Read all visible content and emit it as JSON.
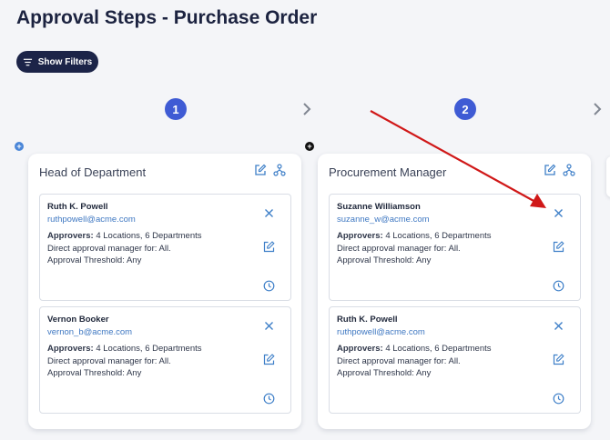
{
  "page": {
    "title": "Approval Steps - Purchase Order"
  },
  "filters": {
    "button_label": "Show Filters",
    "icon": "filter-lines-icon"
  },
  "steps": [
    {
      "number": "1",
      "role": "Head of Department",
      "approvers": [
        {
          "name": "Ruth K. Powell",
          "email": "ruthpowell@acme.com",
          "approvers_label": "Approvers:",
          "approvers_value": " 4 Locations, 6 Departments",
          "direct": "Direct approval manager for: All.",
          "threshold": "Approval Threshold: Any"
        },
        {
          "name": "Vernon Booker",
          "email": "vernon_b@acme.com",
          "approvers_label": "Approvers:",
          "approvers_value": " 4 Locations, 6 Departments",
          "direct": "Direct approval manager for: All.",
          "threshold": "Approval Threshold: Any"
        }
      ]
    },
    {
      "number": "2",
      "role": "Procurement Manager",
      "approvers": [
        {
          "name": "Suzanne Williamson",
          "email": "suzanne_w@acme.com",
          "approvers_label": "Approvers:",
          "approvers_value": " 4 Locations, 6 Departments",
          "direct": "Direct approval manager for: All.",
          "threshold": "Approval Threshold: Any"
        },
        {
          "name": "Ruth K. Powell",
          "email": "ruthpowell@acme.com",
          "approvers_label": "Approvers:",
          "approvers_value": " 4 Locations, 6 Departments",
          "direct": "Direct approval manager for: All.",
          "threshold": "Approval Threshold: Any"
        }
      ]
    }
  ],
  "colors": {
    "accent": "#3f5bd4",
    "dark_button": "#1c2448",
    "icon_blue": "#3e7fc8",
    "annotation_arrow": "#d01818"
  }
}
